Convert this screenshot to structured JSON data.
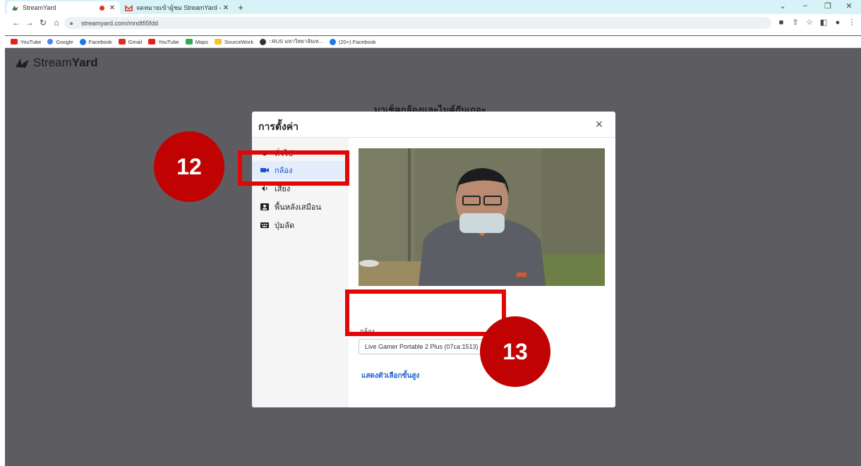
{
  "browser": {
    "tabs": [
      {
        "title": "StreamYard"
      },
      {
        "title": "จดหมายเข้าผู้ชม StreamYard - produ..."
      }
    ],
    "new_tab_label": "+",
    "url": "streamyard.com/mndtfi5fdd",
    "bookmarks": [
      {
        "label": "YouTube",
        "color": "#e62117"
      },
      {
        "label": "Google",
        "color": "#4285f4"
      },
      {
        "label": "Facebook",
        "color": "#1877f2"
      },
      {
        "label": "Gmail",
        "color": "#d93025"
      },
      {
        "label": "YouTube",
        "color": "#e62117"
      },
      {
        "label": "Maps",
        "color": "#34a853"
      },
      {
        "label": "SourceWork",
        "color": "#fbc02d"
      },
      {
        "label": "::RUS มหาวิทยาลัยเท...",
        "color": "#333333"
      },
      {
        "label": "(20+) Facebook",
        "color": "#1877f2"
      }
    ]
  },
  "page": {
    "logo_text_light": "Stream",
    "logo_text_bold": "Yard",
    "behind_title": "มาเช็คกล้องและไมค์กันเถอะ"
  },
  "modal": {
    "title": "การตั้งค่า",
    "close_label": "×",
    "sidebar_items": [
      {
        "label": "ทั่วไป",
        "icon": "gear-icon"
      },
      {
        "label": "กล้อง",
        "icon": "camera-icon",
        "active": true
      },
      {
        "label": "เสียง",
        "icon": "audio-icon"
      },
      {
        "label": "พื้นหลังเสมือน",
        "icon": "portrait-icon"
      },
      {
        "label": "ปุ่มลัด",
        "icon": "keyboard-icon"
      }
    ],
    "camera_label": "กล้อง",
    "camera_select_value": "Live Gamer Portable 2 Plus (07ca:1513)",
    "advanced_link": "แสดงตัวเลือกขั้นสูง"
  },
  "annotations": [
    {
      "number": "12",
      "color": "#c10202"
    },
    {
      "number": "13",
      "color": "#c10202"
    }
  ],
  "colors": {
    "page_background": "#5d5c60",
    "tab_strip": "#d8f3f7",
    "active_nav": "#e3ecfb",
    "link": "#1d5fd1",
    "highlight": "#e30606"
  }
}
